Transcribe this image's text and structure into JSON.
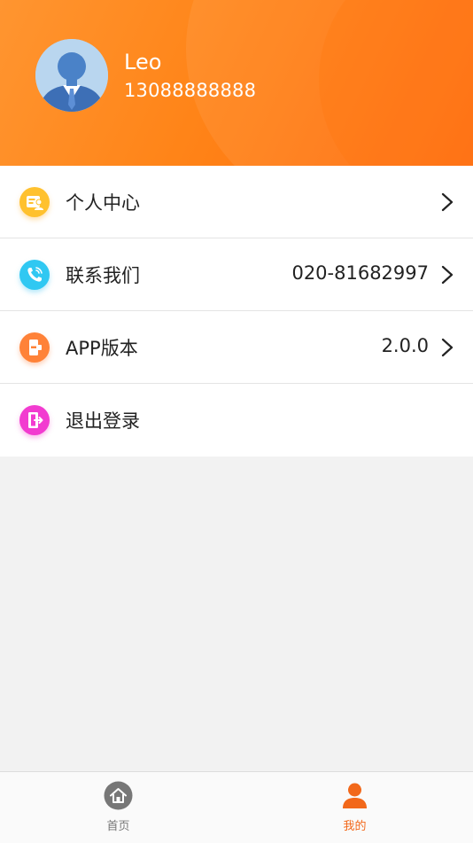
{
  "profile": {
    "name": "Leo",
    "phone": "13088888888"
  },
  "menu": {
    "items": [
      {
        "label": "个人中心",
        "value": "",
        "icon": "profile-card-icon",
        "color": "#ffc12e"
      },
      {
        "label": "联系我们",
        "value": "020-81682997",
        "icon": "phone-icon",
        "color": "#30c8f2"
      },
      {
        "label": "APP版本",
        "value": "2.0.0",
        "icon": "app-version-icon",
        "color": "#ff8238"
      },
      {
        "label": "退出登录",
        "value": "",
        "icon": "logout-icon",
        "color": "#f23bd0"
      }
    ]
  },
  "tabbar": {
    "home_label": "首页",
    "mine_label": "我的",
    "active_color": "#f2681a",
    "inactive_color": "#777777"
  },
  "colors": {
    "header_start": "#ff9530",
    "header_end": "#ff6a0a"
  }
}
